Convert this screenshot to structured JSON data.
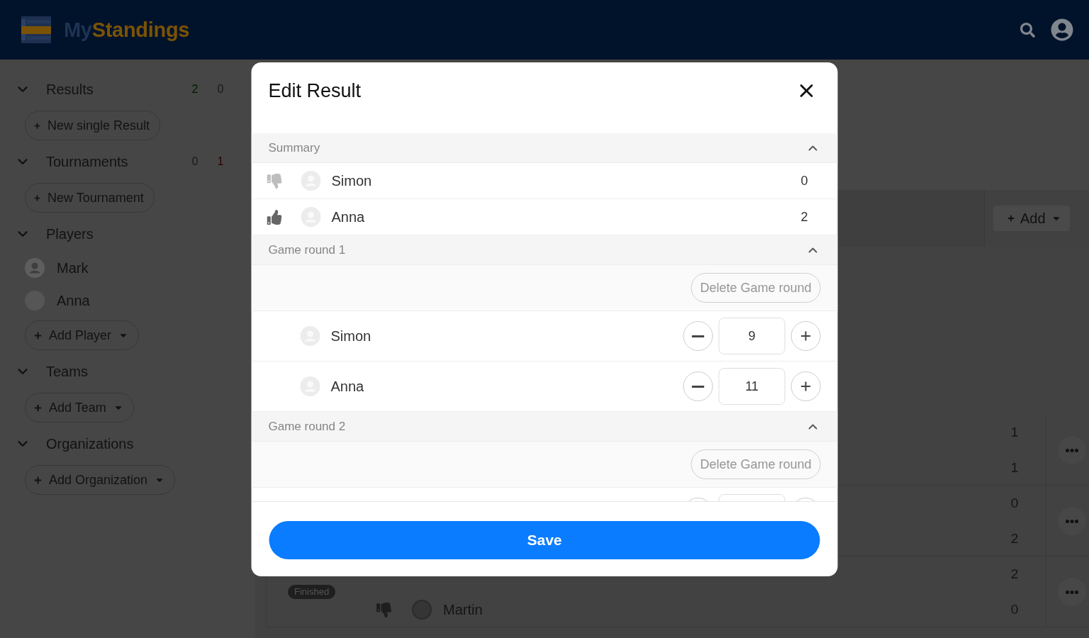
{
  "header": {
    "logo_text": [
      "My",
      "Standings"
    ]
  },
  "sidebar": {
    "sections": [
      {
        "title": "Results",
        "expanded": true,
        "counts": [
          {
            "kind": "won",
            "text": "2",
            "muted": false
          },
          {
            "kind": "lost",
            "text": "0",
            "muted": true
          }
        ],
        "button": {
          "label": "New single Result",
          "kind": "plain"
        }
      },
      {
        "title": "Tournaments",
        "expanded": true,
        "counts": [
          {
            "kind": "won",
            "text": "0",
            "muted": true
          },
          {
            "kind": "lost",
            "text": "1",
            "muted": false
          }
        ],
        "button": {
          "label": "New Tournament",
          "kind": "plain"
        }
      },
      {
        "title": "Players",
        "expanded": true,
        "items": [
          {
            "name": "Mark",
            "kind": "person"
          },
          {
            "name": "Anna",
            "kind": "empty"
          }
        ],
        "button": {
          "label": "Add Player",
          "kind": "dropdown"
        }
      },
      {
        "title": "Teams",
        "expanded": true,
        "button": {
          "label": "Add Team",
          "kind": "dropdown"
        }
      },
      {
        "title": "Organizations",
        "expanded": true,
        "button": {
          "label": "Add Organization",
          "kind": "dropdown"
        }
      }
    ]
  },
  "main": {
    "add_button": "Add",
    "matches": [
      {
        "rows": [
          {
            "score": "1"
          },
          {
            "score": "1"
          }
        ]
      },
      {
        "rows": [
          {
            "score": "0"
          },
          {
            "score": "2"
          }
        ]
      },
      {
        "status": "Finished",
        "rows": [
          {
            "score": "2"
          },
          {
            "name": "Martin",
            "won": false,
            "score": "0"
          }
        ]
      }
    ]
  },
  "dialog": {
    "title": "Edit Result",
    "summary": {
      "title": "Summary",
      "expanded": true,
      "rows": [
        {
          "name": "Simon",
          "won": false,
          "score": "0"
        },
        {
          "name": "Anna",
          "won": true,
          "score": "2"
        }
      ]
    },
    "rounds": [
      {
        "title": "Game round 1",
        "expanded": true,
        "delete_label": "Delete Game round",
        "players": [
          {
            "kind": "player",
            "name": "Simon",
            "value": "9"
          },
          {
            "kind": "player",
            "name": "Anna",
            "value": "11"
          }
        ]
      },
      {
        "title": "Game round 2",
        "expanded": true,
        "delete_label": "Delete Game round",
        "players": [
          {
            "kind": "player"
          }
        ]
      }
    ],
    "save_label": "Save"
  }
}
